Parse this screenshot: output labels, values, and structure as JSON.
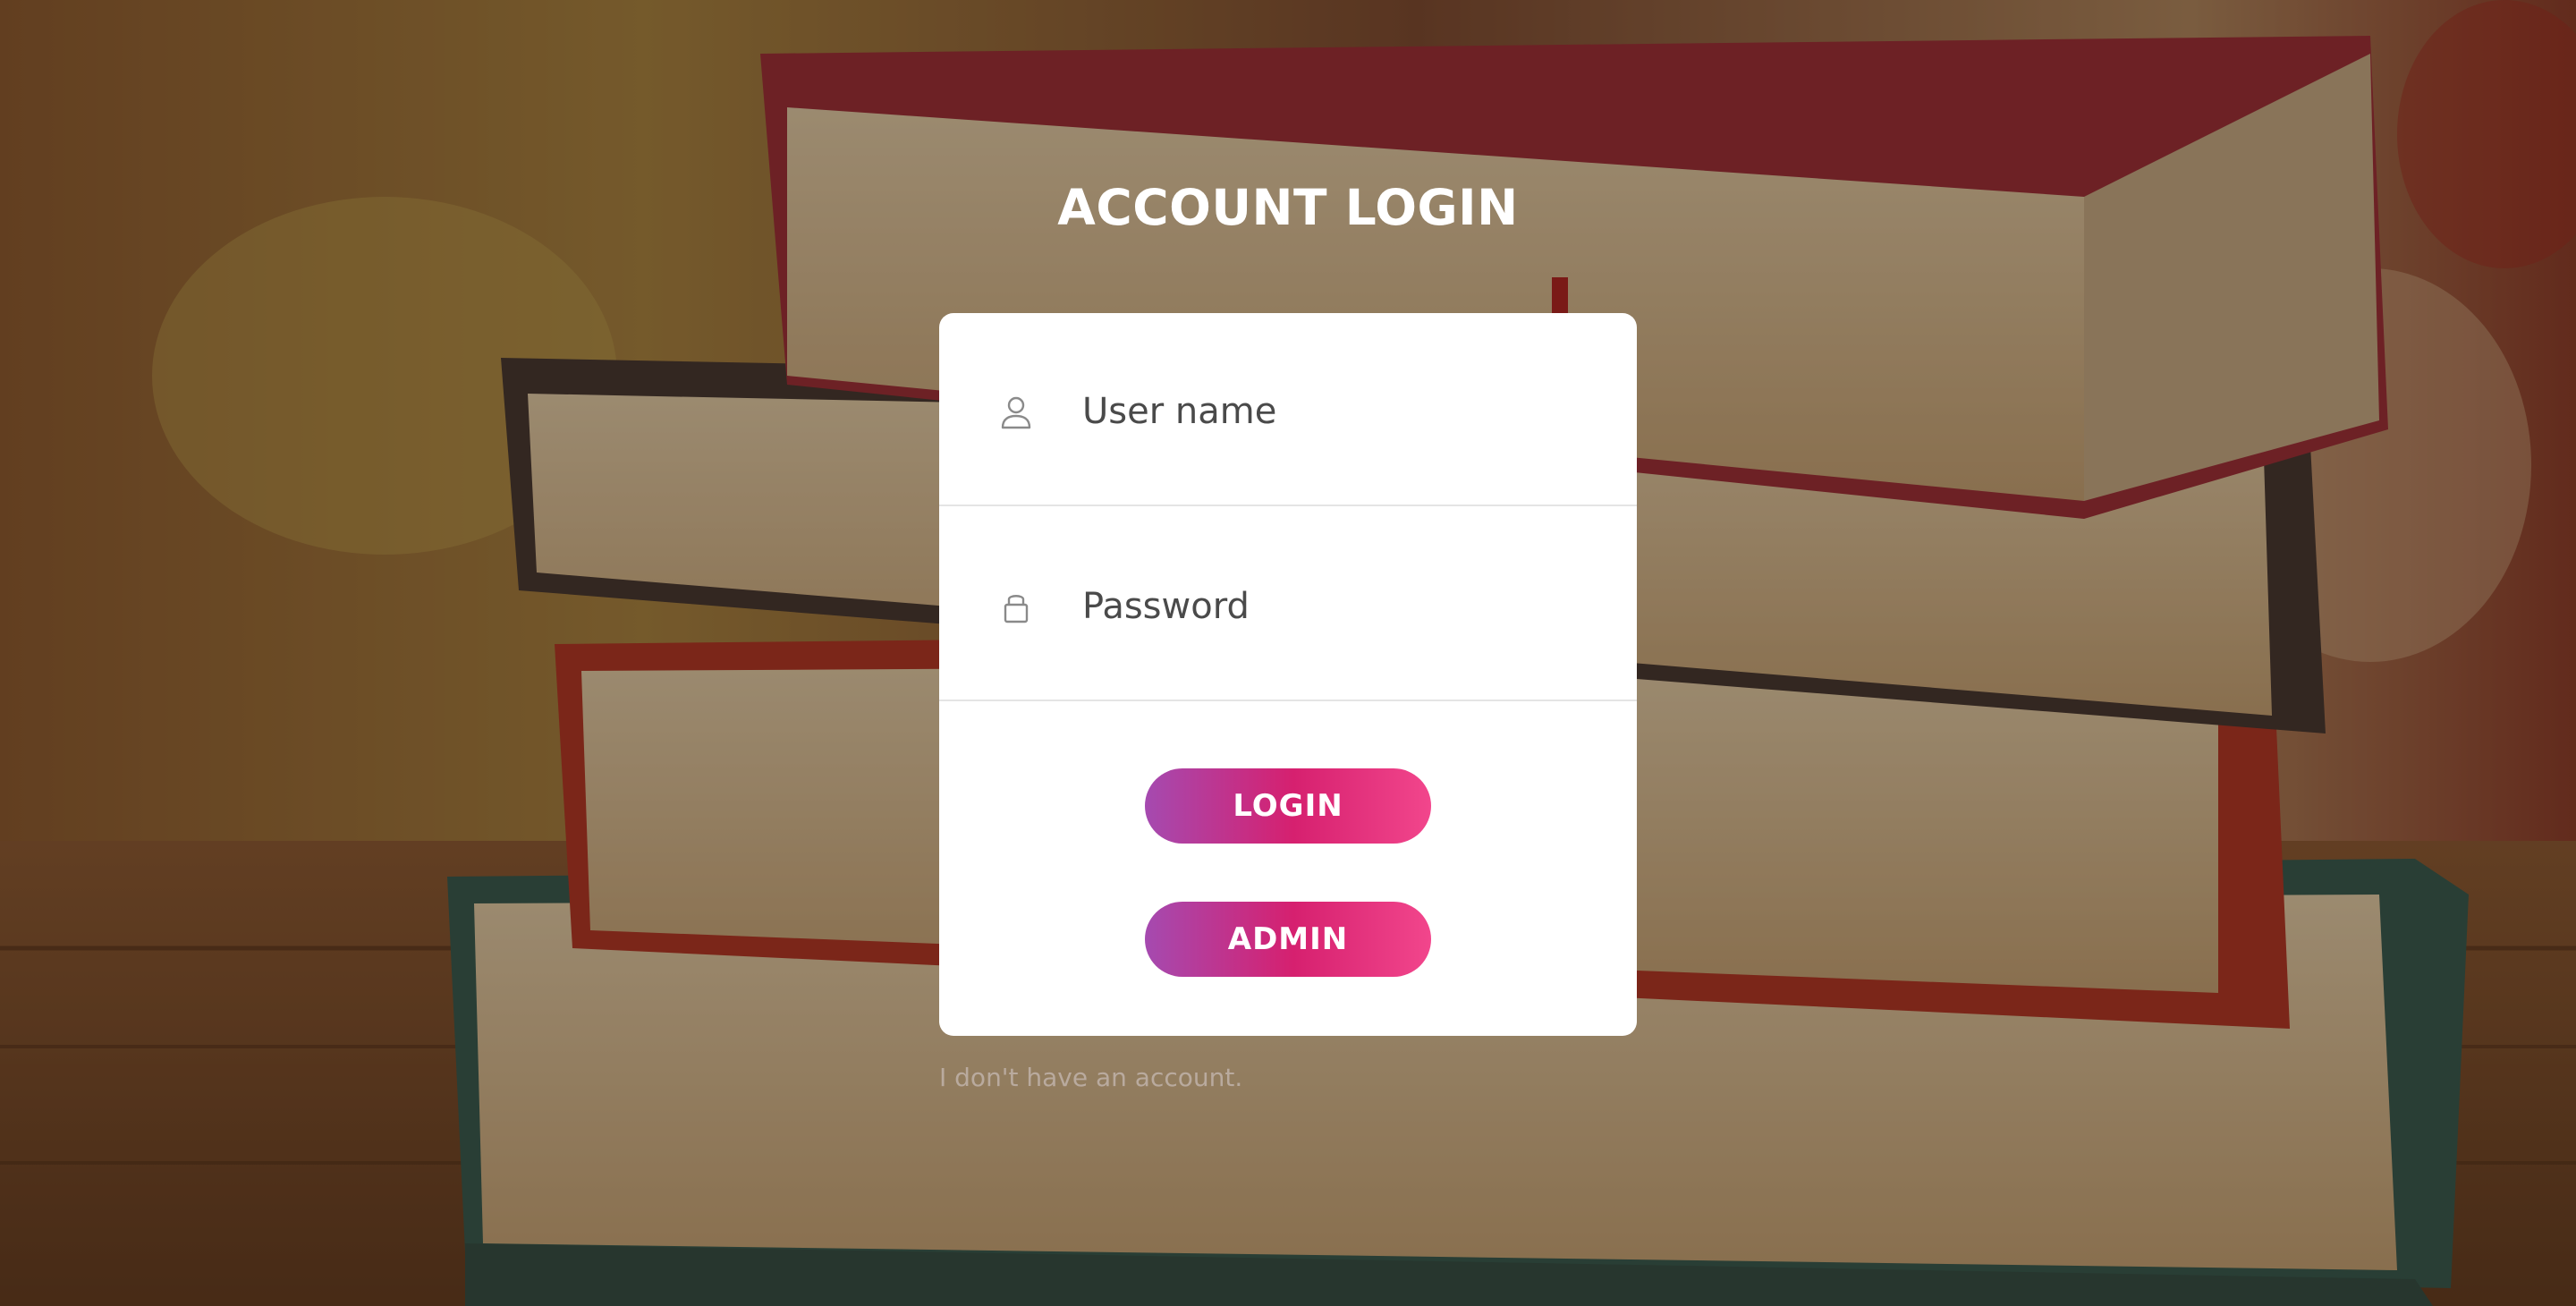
{
  "page": {
    "title": "ACCOUNT LOGIN"
  },
  "form": {
    "username": {
      "placeholder": "User name",
      "value": "",
      "icon": "user-icon"
    },
    "password": {
      "placeholder": "Password",
      "value": "",
      "icon": "lock-icon"
    },
    "login_label": "LOGIN",
    "admin_label": "ADMIN"
  },
  "footer": {
    "no_account_link": "I don't have an account."
  },
  "colors": {
    "button_gradient_start": "#a54ab0",
    "button_gradient_mid": "#d6206f",
    "button_gradient_end": "#f2468c",
    "card_background": "#ffffff",
    "title_color": "#ffffff",
    "link_color": "#b9aa9e"
  },
  "background": {
    "image_subject": "stack of books on wooden table"
  }
}
